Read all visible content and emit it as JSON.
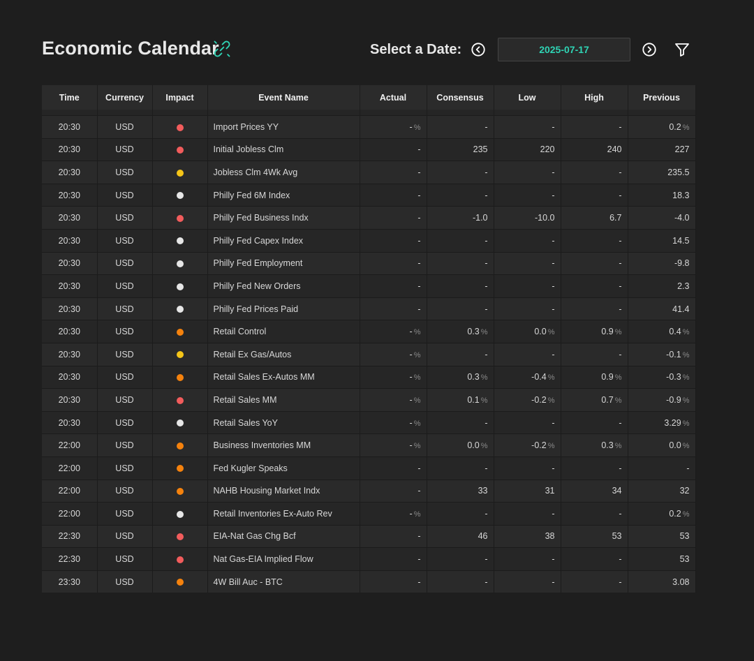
{
  "header": {
    "title": "Economic Calendar",
    "date_label": "Select a Date:",
    "date_value": "2025-07-17",
    "icons": {
      "title_icon": "link-icon",
      "prev": "chevron-left-circle-icon",
      "next": "chevron-right-circle-icon",
      "filter": "filter-icon"
    }
  },
  "colors": {
    "accent": "#2fd3b4",
    "red": "#f25c5c",
    "yellow": "#f5c518",
    "orange": "#f5820d",
    "white": "#e6e6e6"
  },
  "table": {
    "columns": [
      "Time",
      "Currency",
      "Impact",
      "Event Name",
      "Actual",
      "Consensus",
      "Low",
      "High",
      "Previous"
    ],
    "rows": [
      {
        "time": "20:30",
        "currency": "USD",
        "impact": "red",
        "event": "Import Prices YY",
        "actual": {
          "v": "-",
          "pct": true
        },
        "consensus": {
          "v": "-",
          "pct": false
        },
        "low": {
          "v": "-",
          "pct": false
        },
        "high": {
          "v": "-",
          "pct": false
        },
        "previous": {
          "v": "0.2",
          "pct": true
        }
      },
      {
        "time": "20:30",
        "currency": "USD",
        "impact": "red",
        "event": "Initial Jobless Clm",
        "actual": {
          "v": "-",
          "pct": false
        },
        "consensus": {
          "v": "235",
          "pct": false
        },
        "low": {
          "v": "220",
          "pct": false
        },
        "high": {
          "v": "240",
          "pct": false
        },
        "previous": {
          "v": "227",
          "pct": false
        }
      },
      {
        "time": "20:30",
        "currency": "USD",
        "impact": "yellow",
        "event": "Jobless Clm 4Wk Avg",
        "actual": {
          "v": "-",
          "pct": false
        },
        "consensus": {
          "v": "-",
          "pct": false
        },
        "low": {
          "v": "-",
          "pct": false
        },
        "high": {
          "v": "-",
          "pct": false
        },
        "previous": {
          "v": "235.5",
          "pct": false
        }
      },
      {
        "time": "20:30",
        "currency": "USD",
        "impact": "white",
        "event": "Philly Fed 6M Index",
        "actual": {
          "v": "-",
          "pct": false
        },
        "consensus": {
          "v": "-",
          "pct": false
        },
        "low": {
          "v": "-",
          "pct": false
        },
        "high": {
          "v": "-",
          "pct": false
        },
        "previous": {
          "v": "18.3",
          "pct": false
        }
      },
      {
        "time": "20:30",
        "currency": "USD",
        "impact": "red",
        "event": "Philly Fed Business Indx",
        "actual": {
          "v": "-",
          "pct": false
        },
        "consensus": {
          "v": "-1.0",
          "pct": false
        },
        "low": {
          "v": "-10.0",
          "pct": false
        },
        "high": {
          "v": "6.7",
          "pct": false
        },
        "previous": {
          "v": "-4.0",
          "pct": false
        }
      },
      {
        "time": "20:30",
        "currency": "USD",
        "impact": "white",
        "event": "Philly Fed Capex Index",
        "actual": {
          "v": "-",
          "pct": false
        },
        "consensus": {
          "v": "-",
          "pct": false
        },
        "low": {
          "v": "-",
          "pct": false
        },
        "high": {
          "v": "-",
          "pct": false
        },
        "previous": {
          "v": "14.5",
          "pct": false
        }
      },
      {
        "time": "20:30",
        "currency": "USD",
        "impact": "white",
        "event": "Philly Fed Employment",
        "actual": {
          "v": "-",
          "pct": false
        },
        "consensus": {
          "v": "-",
          "pct": false
        },
        "low": {
          "v": "-",
          "pct": false
        },
        "high": {
          "v": "-",
          "pct": false
        },
        "previous": {
          "v": "-9.8",
          "pct": false
        }
      },
      {
        "time": "20:30",
        "currency": "USD",
        "impact": "white",
        "event": "Philly Fed New Orders",
        "actual": {
          "v": "-",
          "pct": false
        },
        "consensus": {
          "v": "-",
          "pct": false
        },
        "low": {
          "v": "-",
          "pct": false
        },
        "high": {
          "v": "-",
          "pct": false
        },
        "previous": {
          "v": "2.3",
          "pct": false
        }
      },
      {
        "time": "20:30",
        "currency": "USD",
        "impact": "white",
        "event": "Philly Fed Prices Paid",
        "actual": {
          "v": "-",
          "pct": false
        },
        "consensus": {
          "v": "-",
          "pct": false
        },
        "low": {
          "v": "-",
          "pct": false
        },
        "high": {
          "v": "-",
          "pct": false
        },
        "previous": {
          "v": "41.4",
          "pct": false
        }
      },
      {
        "time": "20:30",
        "currency": "USD",
        "impact": "orange",
        "event": "Retail Control",
        "actual": {
          "v": "-",
          "pct": true
        },
        "consensus": {
          "v": "0.3",
          "pct": true
        },
        "low": {
          "v": "0.0",
          "pct": true
        },
        "high": {
          "v": "0.9",
          "pct": true
        },
        "previous": {
          "v": "0.4",
          "pct": true
        }
      },
      {
        "time": "20:30",
        "currency": "USD",
        "impact": "yellow",
        "event": "Retail Ex Gas/Autos",
        "actual": {
          "v": "-",
          "pct": true
        },
        "consensus": {
          "v": "-",
          "pct": false
        },
        "low": {
          "v": "-",
          "pct": false
        },
        "high": {
          "v": "-",
          "pct": false
        },
        "previous": {
          "v": "-0.1",
          "pct": true
        }
      },
      {
        "time": "20:30",
        "currency": "USD",
        "impact": "orange",
        "event": "Retail Sales Ex-Autos MM",
        "actual": {
          "v": "-",
          "pct": true
        },
        "consensus": {
          "v": "0.3",
          "pct": true
        },
        "low": {
          "v": "-0.4",
          "pct": true
        },
        "high": {
          "v": "0.9",
          "pct": true
        },
        "previous": {
          "v": "-0.3",
          "pct": true
        }
      },
      {
        "time": "20:30",
        "currency": "USD",
        "impact": "red",
        "event": "Retail Sales MM",
        "actual": {
          "v": "-",
          "pct": true
        },
        "consensus": {
          "v": "0.1",
          "pct": true
        },
        "low": {
          "v": "-0.2",
          "pct": true
        },
        "high": {
          "v": "0.7",
          "pct": true
        },
        "previous": {
          "v": "-0.9",
          "pct": true
        }
      },
      {
        "time": "20:30",
        "currency": "USD",
        "impact": "white",
        "event": "Retail Sales YoY",
        "actual": {
          "v": "-",
          "pct": true
        },
        "consensus": {
          "v": "-",
          "pct": false
        },
        "low": {
          "v": "-",
          "pct": false
        },
        "high": {
          "v": "-",
          "pct": false
        },
        "previous": {
          "v": "3.29",
          "pct": true
        }
      },
      {
        "time": "22:00",
        "currency": "USD",
        "impact": "orange",
        "event": "Business Inventories MM",
        "actual": {
          "v": "-",
          "pct": true
        },
        "consensus": {
          "v": "0.0",
          "pct": true
        },
        "low": {
          "v": "-0.2",
          "pct": true
        },
        "high": {
          "v": "0.3",
          "pct": true
        },
        "previous": {
          "v": "0.0",
          "pct": true
        }
      },
      {
        "time": "22:00",
        "currency": "USD",
        "impact": "orange",
        "event": "Fed Kugler Speaks",
        "actual": {
          "v": "-",
          "pct": false
        },
        "consensus": {
          "v": "-",
          "pct": false
        },
        "low": {
          "v": "-",
          "pct": false
        },
        "high": {
          "v": "-",
          "pct": false
        },
        "previous": {
          "v": "-",
          "pct": false
        }
      },
      {
        "time": "22:00",
        "currency": "USD",
        "impact": "orange",
        "event": "NAHB Housing Market Indx",
        "actual": {
          "v": "-",
          "pct": false
        },
        "consensus": {
          "v": "33",
          "pct": false
        },
        "low": {
          "v": "31",
          "pct": false
        },
        "high": {
          "v": "34",
          "pct": false
        },
        "previous": {
          "v": "32",
          "pct": false
        }
      },
      {
        "time": "22:00",
        "currency": "USD",
        "impact": "white",
        "event": "Retail Inventories Ex-Auto Rev",
        "actual": {
          "v": "-",
          "pct": true
        },
        "consensus": {
          "v": "-",
          "pct": false
        },
        "low": {
          "v": "-",
          "pct": false
        },
        "high": {
          "v": "-",
          "pct": false
        },
        "previous": {
          "v": "0.2",
          "pct": true
        }
      },
      {
        "time": "22:30",
        "currency": "USD",
        "impact": "red",
        "event": "EIA-Nat Gas Chg Bcf",
        "actual": {
          "v": "-",
          "pct": false
        },
        "consensus": {
          "v": "46",
          "pct": false
        },
        "low": {
          "v": "38",
          "pct": false
        },
        "high": {
          "v": "53",
          "pct": false
        },
        "previous": {
          "v": "53",
          "pct": false
        }
      },
      {
        "time": "22:30",
        "currency": "USD",
        "impact": "red",
        "event": "Nat Gas-EIA Implied Flow",
        "actual": {
          "v": "-",
          "pct": false
        },
        "consensus": {
          "v": "-",
          "pct": false
        },
        "low": {
          "v": "-",
          "pct": false
        },
        "high": {
          "v": "-",
          "pct": false
        },
        "previous": {
          "v": "53",
          "pct": false
        }
      },
      {
        "time": "23:30",
        "currency": "USD",
        "impact": "orange",
        "event": "4W Bill Auc - BTC",
        "actual": {
          "v": "-",
          "pct": false
        },
        "consensus": {
          "v": "-",
          "pct": false
        },
        "low": {
          "v": "-",
          "pct": false
        },
        "high": {
          "v": "-",
          "pct": false
        },
        "previous": {
          "v": "3.08",
          "pct": false
        }
      }
    ],
    "percent_symbol": "%"
  }
}
